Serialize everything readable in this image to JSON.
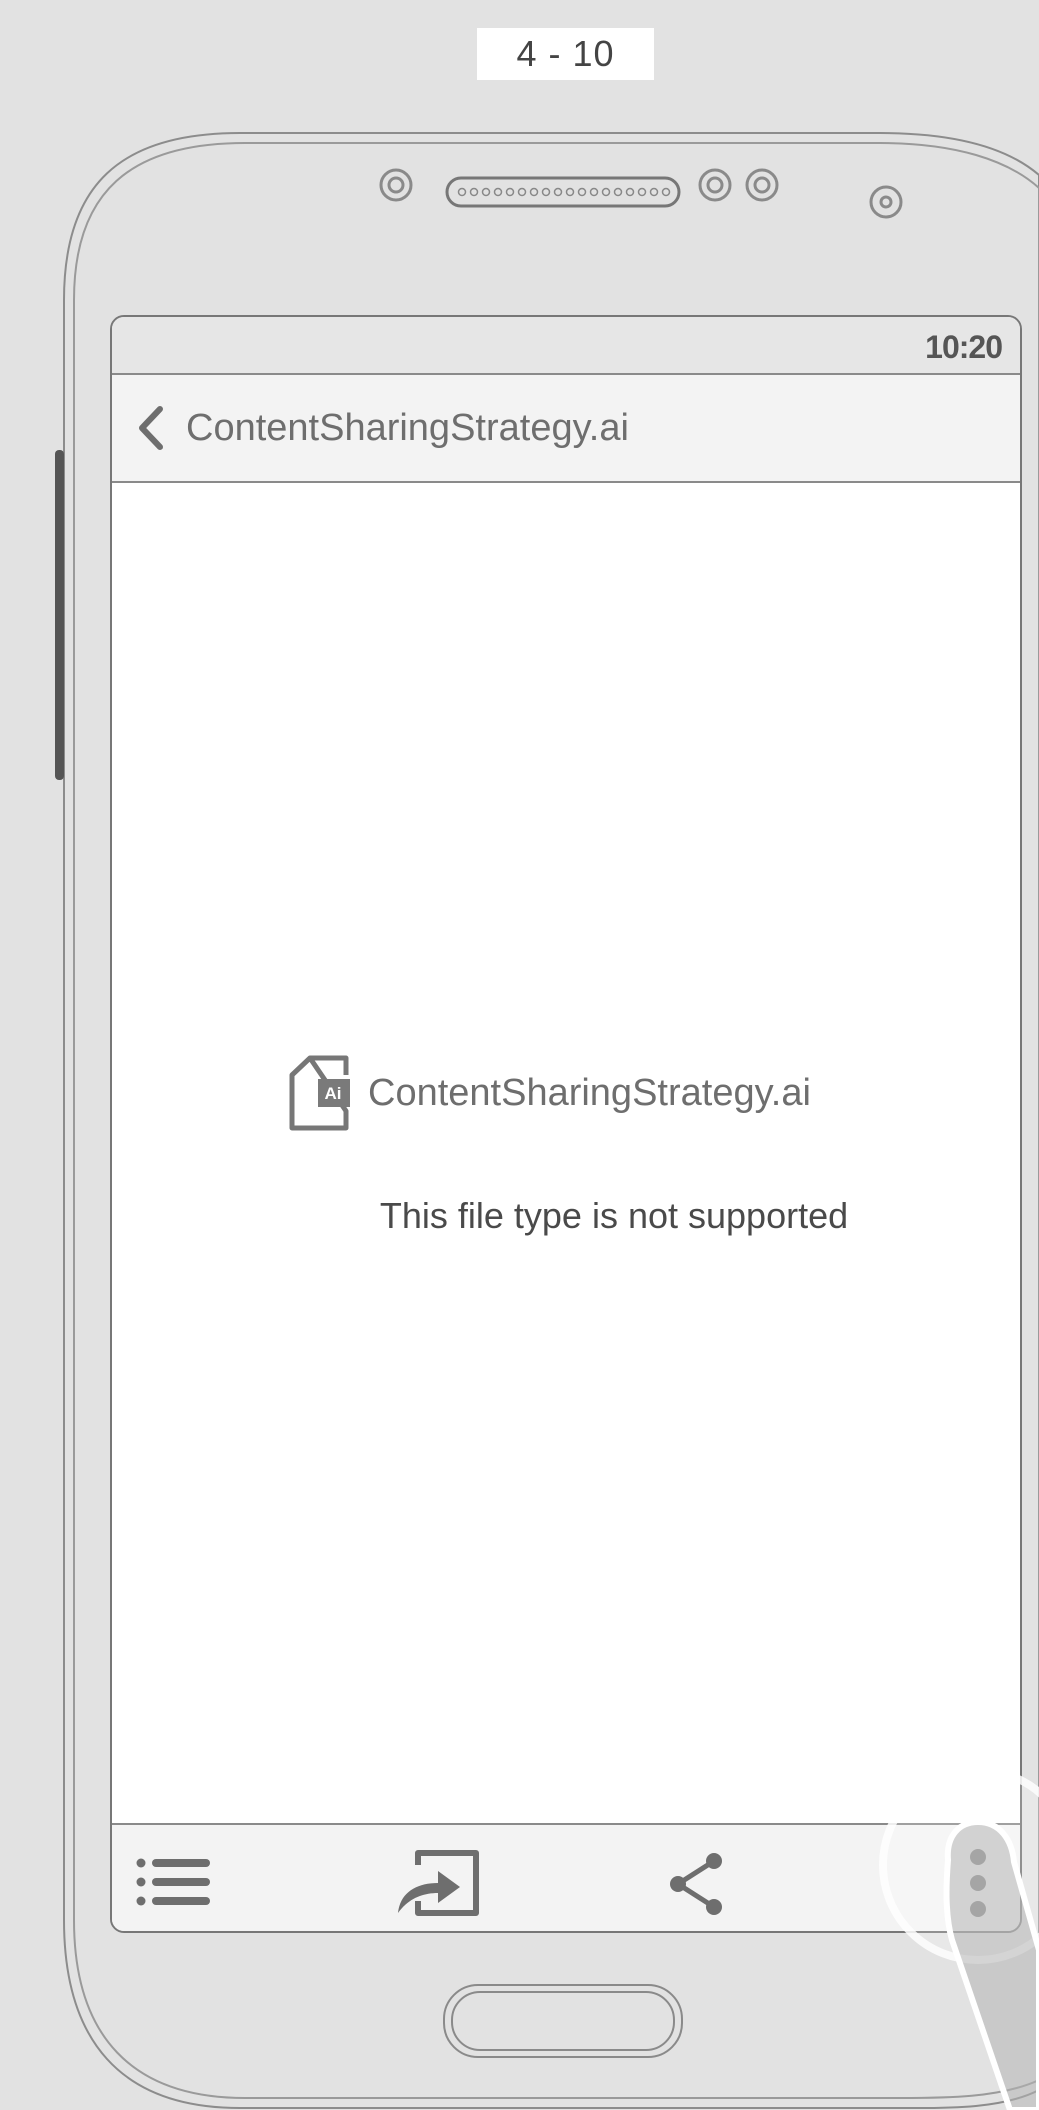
{
  "page_label": "4 - 10",
  "status_bar": {
    "time": "10:20"
  },
  "app_bar": {
    "title": "ContentSharingStrategy.ai",
    "back_icon": "chevron-left-icon"
  },
  "content": {
    "file_badge": "Ai",
    "file_name": "ContentSharingStrategy.ai",
    "message": "This file type is not supported"
  },
  "toolbar": {
    "items": [
      {
        "name": "list-icon"
      },
      {
        "name": "open-in-icon"
      },
      {
        "name": "share-icon"
      },
      {
        "name": "more-vertical-icon"
      }
    ]
  },
  "colors": {
    "background": "#e2e2e2",
    "bar": "#f3f3f3",
    "icon": "#6e6e6e",
    "outline": "#8a8a8a"
  }
}
